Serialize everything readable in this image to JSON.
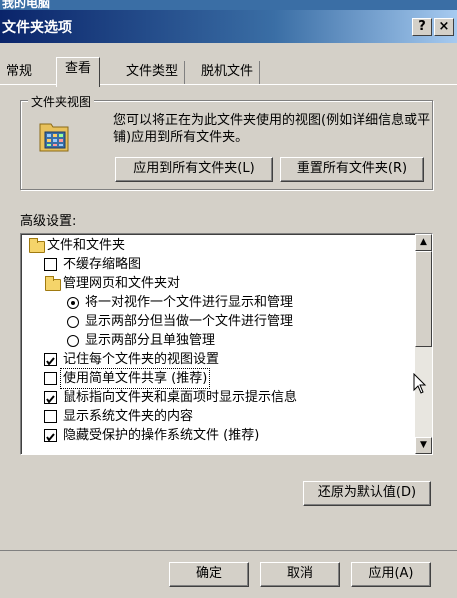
{
  "background_window": {
    "title": "我的电脑"
  },
  "window": {
    "title": "文件夹选项",
    "help_label": "?",
    "close_label": "×"
  },
  "tabs": [
    "常规",
    "查看",
    "文件类型",
    "脱机文件"
  ],
  "active_tab": "查看",
  "folder_views": {
    "group_title": "文件夹视图",
    "description": "您可以将正在为此文件夹使用的视图(例如详细信息或平铺)应用到所有文件夹。",
    "apply_all_label": "应用到所有文件夹(L)",
    "reset_all_label": "重置所有文件夹(R)"
  },
  "advanced": {
    "label": "高级设置:",
    "items": [
      {
        "type": "folder",
        "text": "文件和文件夹",
        "indent": 0
      },
      {
        "type": "checkbox",
        "text": "不缓存缩略图",
        "checked": false,
        "indent": 1
      },
      {
        "type": "folder",
        "text": "管理网页和文件夹对",
        "indent": 1
      },
      {
        "type": "radio",
        "text": "将一对视作一个文件进行显示和管理",
        "checked": true,
        "indent": 2
      },
      {
        "type": "radio",
        "text": "显示两部分但当做一个文件进行管理",
        "checked": false,
        "indent": 2
      },
      {
        "type": "radio",
        "text": "显示两部分且单独管理",
        "checked": false,
        "indent": 2
      },
      {
        "type": "checkbox",
        "text": "记住每个文件夹的视图设置",
        "checked": true,
        "indent": 1
      },
      {
        "type": "checkbox",
        "text": "使用简单文件共享 (推荐)",
        "checked": false,
        "indent": 1,
        "focused": true
      },
      {
        "type": "checkbox",
        "text": "鼠标指向文件夹和桌面项时显示提示信息",
        "checked": true,
        "indent": 1
      },
      {
        "type": "checkbox",
        "text": "显示系统文件夹的内容",
        "checked": false,
        "indent": 1
      },
      {
        "type": "checkbox",
        "text": "隐藏受保护的操作系统文件 (推荐)",
        "checked": true,
        "indent": 1
      }
    ],
    "restore_defaults_label": "还原为默认值(D)"
  },
  "footer": {
    "ok_label": "确定",
    "cancel_label": "取消",
    "apply_label": "应用(A)"
  }
}
